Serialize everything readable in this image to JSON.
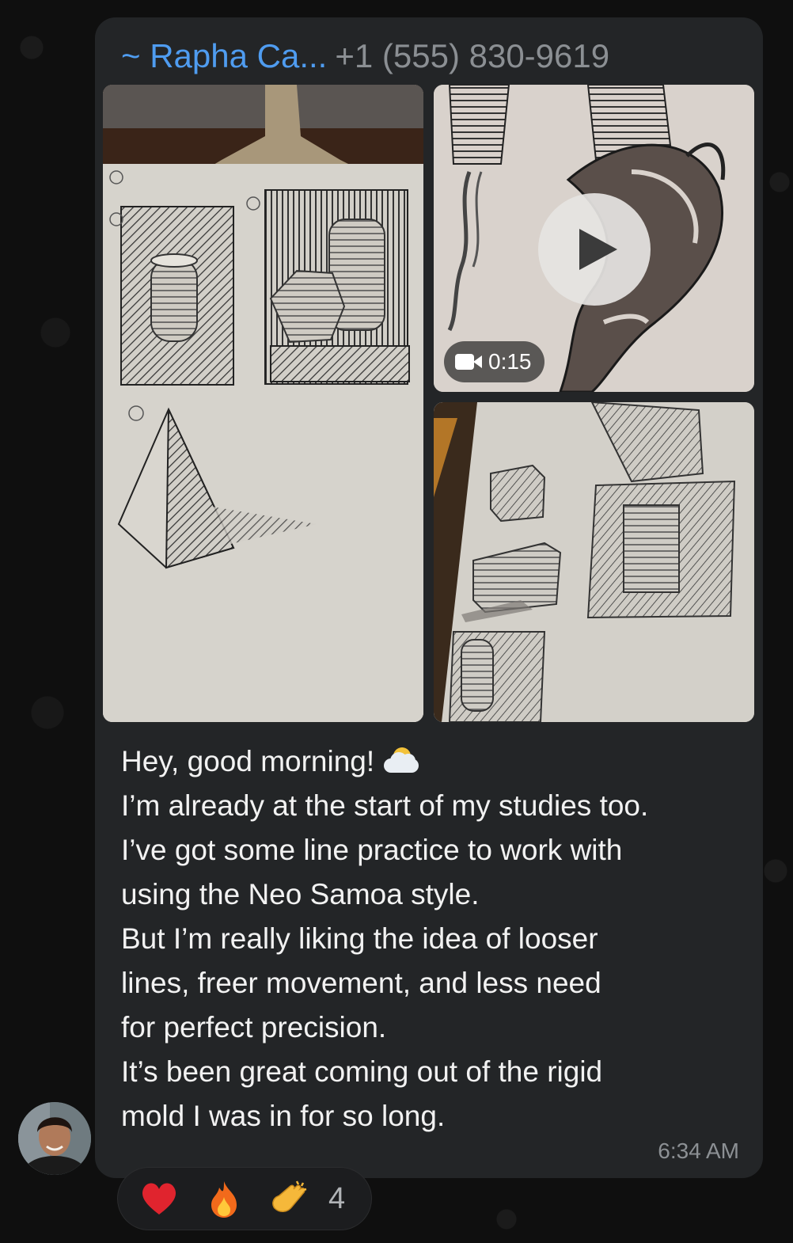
{
  "message": {
    "sender_name": "~ Rapha Ca...",
    "sender_phone": "+1 (555) 830-9619",
    "video_duration": "0:15",
    "text_lines": [
      "Hey, good morning!",
      "I’m already at the start of my studies too.",
      "I’ve got some line practice to work with",
      "using the Neo Samoa style.",
      "But I’m really liking the idea of looser",
      "lines, freer movement, and less need",
      "for perfect precision.",
      "It’s been great coming out of the rigid",
      "mold I was in for so long."
    ],
    "time": "6:34 AM"
  },
  "media": [
    {
      "kind": "photo",
      "icon": "pencil-sketch-cylinder-pyramid"
    },
    {
      "kind": "video",
      "icon": "play-icon"
    },
    {
      "kind": "photo",
      "icon": "pencil-sketch-cubes"
    }
  ],
  "reactions": {
    "emojis": [
      "heart-icon",
      "fire-icon",
      "clapping-hands-icon"
    ],
    "count": "4"
  },
  "colors": {
    "sender_name": "#4f9cf0",
    "bubble": "#232527",
    "background": "#0f0f0f"
  }
}
